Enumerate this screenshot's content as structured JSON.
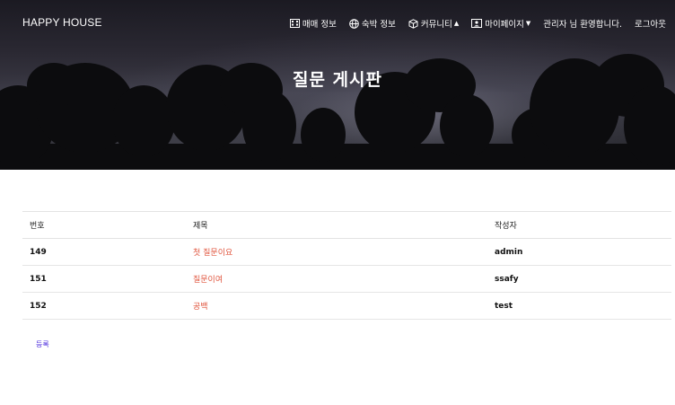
{
  "brand": "HAPPY HOUSE",
  "nav": [
    {
      "label": "매매 정보",
      "icon": "building-icon",
      "dropdown": false
    },
    {
      "label": "숙박 정보",
      "icon": "globe-icon",
      "dropdown": false
    },
    {
      "label": "커뮤니티",
      "icon": "box-icon",
      "dropdown": true
    },
    {
      "label": "마이페이지",
      "icon": "id-card-icon",
      "dropdown": true
    }
  ],
  "greeting": "관리자 님 환영합니다.",
  "logout": "로그아웃",
  "page_title": "질문 게시판",
  "table": {
    "headers": [
      "번호",
      "제목",
      "작성자"
    ],
    "rows": [
      {
        "no": "149",
        "title": "첫 질문이요",
        "author": "admin"
      },
      {
        "no": "151",
        "title": "질문이여",
        "author": "ssafy"
      },
      {
        "no": "152",
        "title": "공백",
        "author": "test"
      }
    ]
  },
  "register_label": "등록",
  "colors": {
    "title_link": "#e0553e",
    "register_link": "#4b2bdc"
  }
}
